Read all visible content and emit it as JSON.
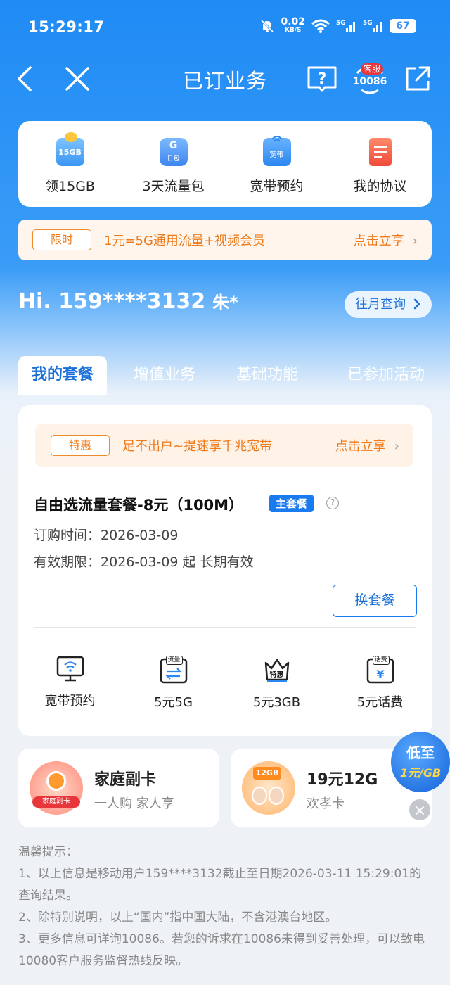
{
  "status_bar": {
    "time": "15:29:17",
    "speed_value": "0.02",
    "speed_unit": "KB/S",
    "battery": "67"
  },
  "nav": {
    "title": "已订业务",
    "service_badge": "客服",
    "service_number": "10086"
  },
  "quick_actions": [
    {
      "label": "领15GB",
      "icon": "15gb-gift-icon",
      "icon_text": "15GB"
    },
    {
      "label": "3天流量包",
      "icon": "day-pack-icon",
      "icon_text": "G"
    },
    {
      "label": "宽带预约",
      "icon": "broadband-icon",
      "icon_text": "宽带"
    },
    {
      "label": "我的协议",
      "icon": "document-icon"
    }
  ],
  "promo_banner": {
    "tag": "限时",
    "text": "1元=5G通用流量+视频会员",
    "action": "点击立享",
    "arrow": "›"
  },
  "user": {
    "greeting": "Hi.",
    "phone": "159****3132",
    "name": "朱*",
    "history_label": "往月查询"
  },
  "tabs": [
    "我的套餐",
    "增值业务",
    "基础功能",
    "已参加活动"
  ],
  "plan": {
    "promo": {
      "tag": "特惠",
      "text": "足不出户~提速享千兆宽带",
      "action": "点击立享",
      "arrow": "›"
    },
    "name": "自由选流量套餐-8元（100M）",
    "badge": "主套餐",
    "order_label": "订购时间：",
    "order_date": "2026-03-09",
    "valid_label": "有效期限：",
    "valid_value": "2026-03-09 起 长期有效",
    "change_label": "换套餐"
  },
  "features": [
    {
      "label": "宽带预约",
      "icon": "broadband-tv-icon"
    },
    {
      "label": "5元5G",
      "icon": "data-swap-icon",
      "icon_text": "流量"
    },
    {
      "label": "5元3GB",
      "icon": "crown-deal-icon",
      "icon_text": "特惠"
    },
    {
      "label": "5元话费",
      "icon": "phone-credit-icon",
      "icon_text": "话费"
    }
  ],
  "mini_cards": [
    {
      "title": "家庭副卡",
      "subtitle": "一人购 家人享",
      "icon_text": "家庭副卡"
    },
    {
      "title": "19元12G",
      "subtitle": "欢孝卡",
      "icon_text": "12GB"
    }
  ],
  "float_badge": {
    "line1": "低至",
    "line2": "1元/GB"
  },
  "tips": {
    "title": "温馨提示：",
    "lines": [
      "1、以上信息是移动用户159****3132截止至日期2026-03-11 15:29:01的查询结果。",
      "2、除特别说明，以上“国内”指中国大陆，不含港澳台地区。",
      "3、更多信息可详询10086。若您的诉求在10086未得到妥善处理，可以致电10080客户服务监督热线反映。"
    ]
  },
  "colors": {
    "brand_blue": "#1a7bf0",
    "promo_orange": "#ef7a1a",
    "header_gradient_top": "#1f8bf5"
  }
}
